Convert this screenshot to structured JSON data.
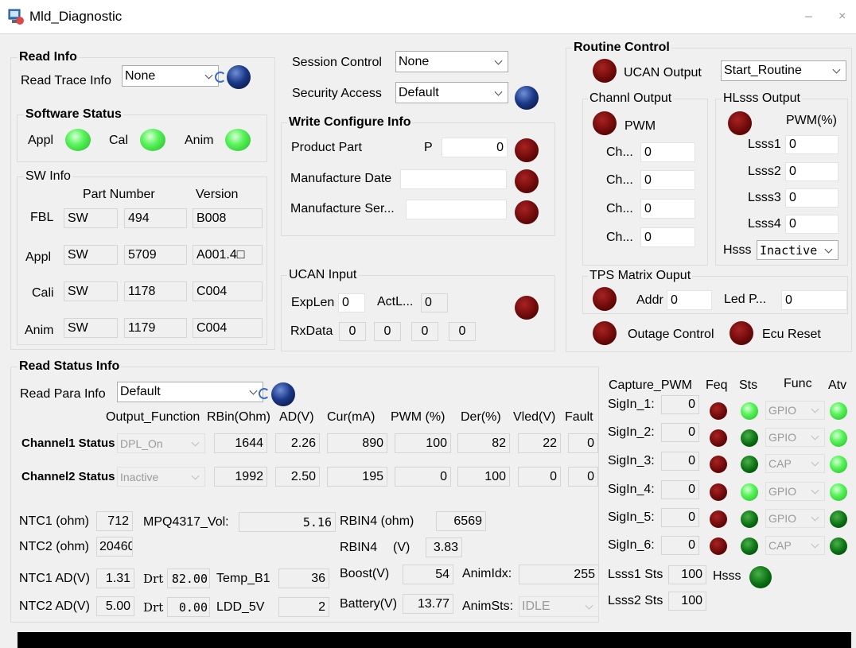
{
  "window": {
    "title": "Mld_Diagnostic",
    "minimize": "–",
    "close": "×"
  },
  "read_info": {
    "group": "Read Info",
    "trace_label": "Read Trace Info",
    "trace_value": "None"
  },
  "software_status": {
    "group": "Software Status",
    "appl": "Appl",
    "cal": "Cal",
    "anim": "Anim"
  },
  "sw_info": {
    "group": "SW Info",
    "col_part": "Part Number",
    "col_version": "Version",
    "rows": [
      {
        "label": "FBL",
        "prefix": "SW",
        "part": "494",
        "version": "B008"
      },
      {
        "label": "Appl",
        "prefix": "SW",
        "part": "5709",
        "version": "A001.4□"
      },
      {
        "label": "Cali",
        "prefix": "SW",
        "part": "1178",
        "version": "C004"
      },
      {
        "label": "Anim",
        "prefix": "SW",
        "part": "1179",
        "version": "C004"
      }
    ]
  },
  "session": {
    "session_label": "Session Control",
    "session_value": "None",
    "security_label": "Security Access",
    "security_value": "Default"
  },
  "write_config": {
    "group": "Write Configure Info",
    "product_label": "Product Part",
    "product_prefix": "P",
    "product_value": "0",
    "mfg_date_label": "Manufacture Date",
    "mfg_date_value": "",
    "mfg_ser_label": "Manufacture Ser...",
    "mfg_ser_value": ""
  },
  "ucan_input": {
    "group": "UCAN Input",
    "explen_label": "ExpLen",
    "explen_value": "0",
    "actlen_label": "ActL...",
    "actlen_value": "0",
    "rxdata_label": "RxData",
    "rxdata": [
      "0",
      "0",
      "0",
      "0"
    ]
  },
  "routine": {
    "group": "Routine Control",
    "ucan_output": "UCAN Output",
    "routine_value": "Start_Routine",
    "channl_group": "Channl Output",
    "pwm_label": "PWM",
    "ch_label": "Ch...",
    "ch_values": [
      "0",
      "0",
      "0",
      "0"
    ],
    "hlsss_group": "HLsss Output",
    "pwm_pct_label": "PWM(%)",
    "lsss": [
      {
        "label": "Lsss1",
        "value": "0"
      },
      {
        "label": "Lsss2",
        "value": "0"
      },
      {
        "label": "Lsss3",
        "value": "0"
      },
      {
        "label": "Lsss4",
        "value": "0"
      }
    ],
    "hsss_label": "Hsss",
    "hsss_value": "Inactive",
    "tps_group": "TPS Matrix Ouput",
    "addr_label": "Addr",
    "addr_value": "0",
    "ledp_label": "Led P...",
    "ledp_value": "0",
    "outage": "Outage Control",
    "ecu_reset": "Ecu Reset"
  },
  "read_status": {
    "group": "Read Status Info",
    "para_label": "Read Para Info",
    "para_value": "Default",
    "headers": [
      "Output_Function",
      "RBin(Ohm)",
      "AD(V)",
      "Cur(mA)",
      "PWM (%)",
      "Der(%)",
      "Vled(V)",
      "Fault"
    ],
    "ch1": {
      "label": "Channel1 Status",
      "func": "DPL_On",
      "rbin": "1644",
      "ad": "2.26",
      "cur": "890",
      "pwm": "100",
      "der": "82",
      "vled": "22",
      "fault": "0"
    },
    "ch2": {
      "label": "Channel2 Status",
      "func": "Inactive",
      "rbin": "1992",
      "ad": "2.50",
      "cur": "195",
      "pwm": "0",
      "der": "100",
      "vled": "0",
      "fault": "0"
    },
    "ntc1_label": "NTC1 (ohm)",
    "ntc1": "712",
    "mpq_label": "MPQ4317_Vol:",
    "mpq": "5.16",
    "rbin4_ohm_label": "RBIN4 (ohm)",
    "rbin4_ohm": "6569",
    "ntc2_label": "NTC2 (ohm)",
    "ntc2": "20460",
    "rbin4_v_label": "RBIN4",
    "rbin4_v_unit": "(V)",
    "rbin4_v": "3.83",
    "ntc1ad_label": "NTC1 AD(V)",
    "ntc1ad": "1.31",
    "drt_label": "Drt",
    "drt1": "82.00",
    "tempb1_label": "Temp_B1",
    "tempb1": "36",
    "boost_label": "Boost(V)",
    "boost": "54",
    "animidx_label": "AnimIdx:",
    "animidx": "255",
    "ntc2ad_label": "NTC2 AD(V)",
    "ntc2ad": "5.00",
    "drt2": "0.00",
    "ldd_label": "LDD_5V",
    "ldd": "2",
    "battery_label": "Battery(V)",
    "battery": "13.77",
    "animsts_label": "AnimSts:",
    "animsts": "IDLE"
  },
  "capture": {
    "title": "Capture_PWM",
    "col_feq": "Feq",
    "col_sts": "Sts",
    "col_func": "Func",
    "col_atv": "Atv",
    "rows": [
      {
        "label": "SigIn_1:",
        "value": "0",
        "func": "GPIO",
        "sts": "light",
        "atv": "light"
      },
      {
        "label": "SigIn_2:",
        "value": "0",
        "func": "GPIO",
        "sts": "dark",
        "atv": "light"
      },
      {
        "label": "SigIn_3:",
        "value": "0",
        "func": "CAP",
        "sts": "dark",
        "atv": "light"
      },
      {
        "label": "SigIn_4:",
        "value": "0",
        "func": "GPIO",
        "sts": "light",
        "atv": "light"
      },
      {
        "label": "SigIn_5:",
        "value": "0",
        "func": "GPIO",
        "sts": "dark",
        "atv": "dark"
      },
      {
        "label": "SigIn_6:",
        "value": "0",
        "func": "CAP",
        "sts": "dark",
        "atv": "dark"
      }
    ],
    "lsss1_label": "Lsss1 Sts",
    "lsss1": "100",
    "hsss_label": "Hsss",
    "lsss2_label": "Lsss2 Sts",
    "lsss2": "100"
  },
  "colors": {
    "led_dark_red": "#6e0a0a",
    "led_dark_blue": "#1c3a8a",
    "led_light_green": "#59f35b",
    "led_dark_green": "#0a6e12"
  }
}
